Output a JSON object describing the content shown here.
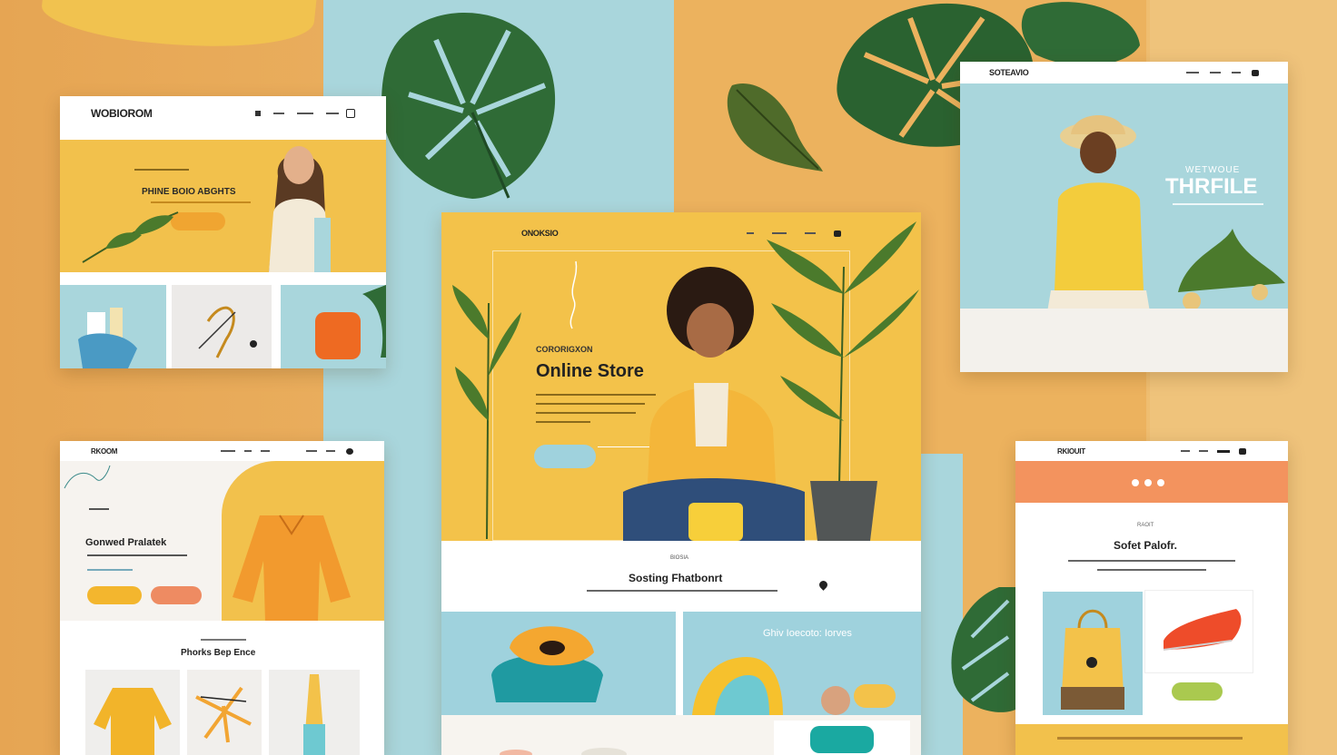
{
  "card_top_left": {
    "brand": "WOBIOROM",
    "headline": "PHINE BOIO ABGHTS",
    "hero_color": "#f0c14a"
  },
  "card_top_right": {
    "brand": "SOTEAVIO",
    "headline": "THRFILE",
    "kicker": "WETWOUE"
  },
  "card_center": {
    "brand": "ONOKSIO",
    "kicker": "CORORIGXON",
    "headline": "Online Store",
    "section_kicker": "BIOSIA",
    "section_title": "Sosting Fhatbonrt",
    "promo_title": "Ghiv Ioecoto: Iorves"
  },
  "card_bottom_left": {
    "brand": "RKOOM",
    "headline": "Gonwed Pralatek",
    "section_title": "Phorks Bep Ence"
  },
  "card_bottom_right": {
    "brand": "RKIOUIT",
    "kicker": "RAOIT",
    "headline": "Sofet Palofr."
  },
  "colors": {
    "accent_orange": "#f0a531",
    "accent_coral": "#ee8b62",
    "accent_blue": "#9fd2dd",
    "accent_yellow": "#f3c24a",
    "accent_green": "#aac94f"
  }
}
